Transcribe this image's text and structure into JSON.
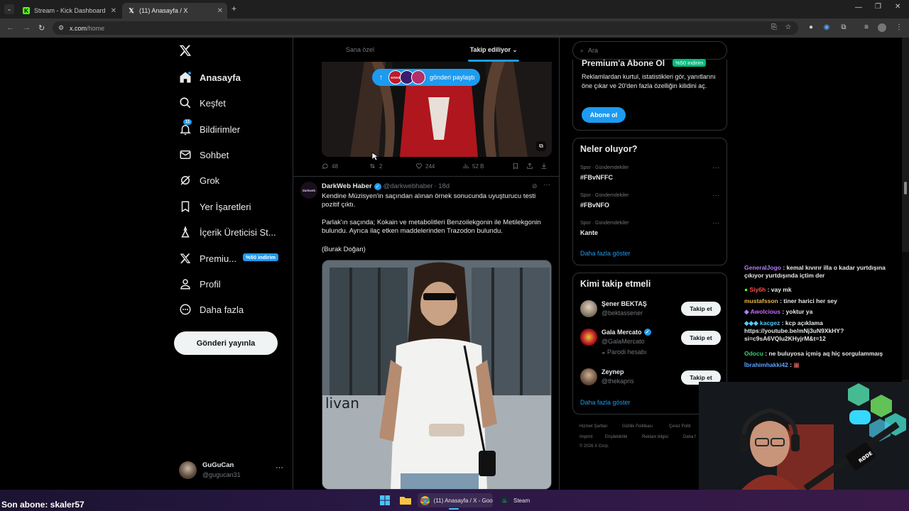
{
  "browser": {
    "tabs": [
      {
        "label": "Stream - Kick Dashboard",
        "active": false
      },
      {
        "label": "(11) Anasayfa / X",
        "active": true
      }
    ],
    "url_domain": "x.com",
    "url_path": "/home"
  },
  "sidebar": {
    "logo": "X",
    "items": [
      {
        "label": "Anasayfa",
        "icon": "home-icon",
        "active": true
      },
      {
        "label": "Keşfet",
        "icon": "search-icon",
        "active": false
      },
      {
        "label": "Bildirimler",
        "icon": "bell-icon",
        "active": false,
        "badge": "11"
      },
      {
        "label": "Sohbet",
        "icon": "envelope-icon",
        "active": false
      },
      {
        "label": "Grok",
        "icon": "grok-icon",
        "active": false
      },
      {
        "label": "Yer İşaretleri",
        "icon": "bookmark-icon",
        "active": false
      },
      {
        "label": "İçerik Üreticisi St...",
        "icon": "creator-studio-icon",
        "active": false
      },
      {
        "label": "Premiu...",
        "icon": "x-premium-icon",
        "active": false,
        "badge": "%50 indirim"
      },
      {
        "label": "Profil",
        "icon": "user-icon",
        "active": false
      },
      {
        "label": "Daha fazla",
        "icon": "more-circle-icon",
        "active": false
      }
    ],
    "post_button": "Gönderi yayınla",
    "account": {
      "name": "GuGuCan",
      "handle": "@gugucan31"
    }
  },
  "feed": {
    "tabs": [
      {
        "label": "Sana özel",
        "active": false
      },
      {
        "label": "Takip ediliyor",
        "active": true
      }
    ],
    "share_pill": {
      "arrow": "↑",
      "label": "gönderi paylaştı",
      "brand": "KIYAS"
    },
    "post1_stats": {
      "replies": "48",
      "reposts": "2",
      "likes": "244",
      "views": "52 B"
    },
    "post2": {
      "author": "DarkWeb Haber",
      "handle": "@darkwebhaber",
      "time": "· 18d",
      "avatar_text": "darkweb",
      "paragraphs": [
        "Kendine Müzisyen'in saçından alınan örnek sonucunda uyuşturucu testi pozitif çıktı.",
        "Parlak'ın saçında; Kokain ve metabolitleri Benzoilekgonin ile Metilekgonin bulundu. Ayrıca ilaç etken maddelerinden Trazodon bulundu.",
        "(Burak Doğan)"
      ],
      "image_sign": "livan"
    }
  },
  "right": {
    "search_placeholder": "Ara",
    "premium": {
      "title": "Premium'a Abone Ol",
      "badge": "%50 indirim",
      "text": "Reklamlardan kurtul, istatistikleri gör, yanıtlarını öne çıkar ve 20'den fazla özelliğin kilidini aç.",
      "button": "Abone ol"
    },
    "trends": {
      "title": "Neler oluyor?",
      "items": [
        {
          "category": "Spor · Gündemdekiler",
          "name": "#FBvNFFC"
        },
        {
          "category": "Spor · Gündemdekiler",
          "name": "#FBvNFO"
        },
        {
          "category": "Spor · Gündemdekiler",
          "name": "Kante"
        }
      ],
      "more": "Daha fazla göster"
    },
    "who_to_follow": {
      "title": "Kimi takip etmeli",
      "items": [
        {
          "name": "Şener BEKTAŞ",
          "handle": "@bektassener",
          "button": "Takip et"
        },
        {
          "name": "Gala Mercato",
          "handle": "@GalaMercato",
          "extra": "Parodi hesabı",
          "button": "Takip et"
        },
        {
          "name": "Zeynep",
          "handle": "@thekapris",
          "button": "Takip et"
        }
      ],
      "more": "Daha fazla göster"
    },
    "footer": {
      "row1": [
        "Hizmet Şartları",
        "Gizlilik Politikası",
        "Çerez Politi"
      ],
      "row2": [
        "Imprint",
        "Erişilebilirlik",
        "Reklam bilgisi",
        "Daha f"
      ],
      "copyright": "© 2026 X Corp."
    }
  },
  "chat": {
    "lines": [
      {
        "user": "GeneralJogo",
        "color": "#b77cff",
        "text": ": kemal kıvırır illa o kadar yurtdışına çıkıyor yurtdışında içtim der"
      },
      {
        "user": "Siy6h",
        "color": "#ff4d4d",
        "text": ": vay mk"
      },
      {
        "user": "mustafsson",
        "color": "#e6b84a",
        "text": ": tiner harici her sey"
      },
      {
        "user": "Awolcious",
        "color": "#c86bff",
        "text": ": yoktur ya"
      },
      {
        "user": "kacgez",
        "color": "#53c9ff",
        "text": ": kcp açıklama https://youtube.be/mNj3uN9XkHY?si=c9sA6VQlu2KHyjrM&t=12"
      },
      {
        "user": "Odocu",
        "color": "#3ad07a",
        "text": ": ne buluyosa içmiş aq hiç sorgulammaış"
      },
      {
        "user": "İbrahimhakki42",
        "color": "#5ba4ff",
        "text": ":"
      }
    ]
  },
  "overlay": {
    "last_sub": "Son abone: skaler57",
    "mic_brand": "RØDE"
  },
  "taskbar": {
    "items": [
      {
        "label": "(11) Anasayfa / X - Goog",
        "icon": "chrome-icon"
      },
      {
        "label": "Steam",
        "icon": "steam-icon"
      }
    ]
  },
  "colors": {
    "accent": "#1d9bf0",
    "background": "#000000",
    "border": "#2f3336",
    "secondary_text": "#71767b",
    "premium_badge": "#00ba7c"
  }
}
